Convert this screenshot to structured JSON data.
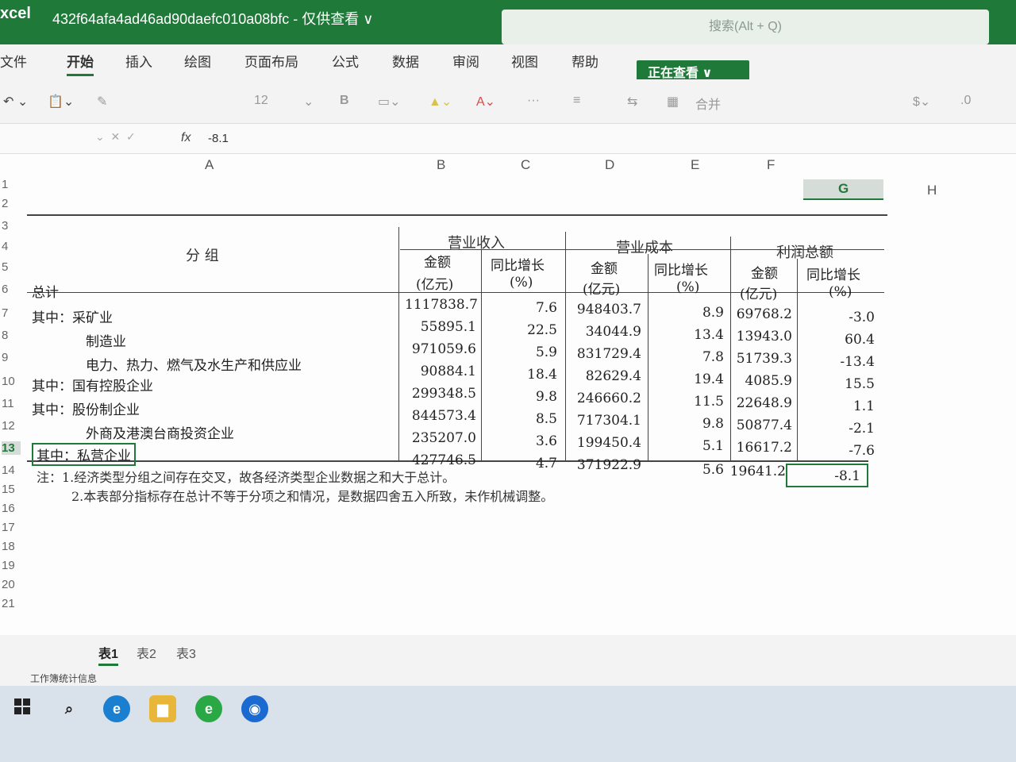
{
  "titlebar": {
    "app_name": "xcel",
    "doc_title": "432f64afa4ad46ad90daefc010a08bfc - 仅供查看 ∨",
    "search_placeholder": "搜索(Alt + Q)"
  },
  "ribbon": {
    "tabs": [
      "文件",
      "开始",
      "插入",
      "绘图",
      "页面布局",
      "公式",
      "数据",
      "审阅",
      "视图",
      "帮助"
    ],
    "active_tab": "开始",
    "viewing_button": "正在查看 ∨"
  },
  "toolbar": {
    "font_size": "12",
    "merge_label": "合并"
  },
  "formula_bar": {
    "fx": "fx",
    "value": "-8.1"
  },
  "columns": [
    "A",
    "B",
    "C",
    "D",
    "E",
    "F",
    "G",
    "H"
  ],
  "selected_column": "G",
  "rows": [
    "1",
    "2",
    "3",
    "4",
    "5",
    "6",
    "7",
    "8",
    "9",
    "10",
    "11",
    "12",
    "13",
    "14",
    "15",
    "16",
    "17",
    "18",
    "19",
    "20",
    "21"
  ],
  "selected_row": "13",
  "table": {
    "group_header": "分 组",
    "revenue_header": "营业收入",
    "cost_header": "营业成本",
    "profit_header": "利润总额",
    "amount_label": "金额",
    "amount_unit": "(亿元)",
    "growth_label": "同比增长",
    "growth_unit": "(%)",
    "rows": [
      {
        "label": "总计",
        "rev": "1117838.7",
        "rev_g": "7.6",
        "cost": "948403.7",
        "cost_g": "8.9",
        "profit": "69768.2",
        "profit_g": "-3.0"
      },
      {
        "label": "其中：采矿业",
        "rev": "55895.1",
        "rev_g": "22.5",
        "cost": "34044.9",
        "cost_g": "13.4",
        "profit": "13943.0",
        "profit_g": "60.4"
      },
      {
        "label": "制造业",
        "rev": "971059.6",
        "rev_g": "5.9",
        "cost": "831729.4",
        "cost_g": "7.8",
        "profit": "51739.3",
        "profit_g": "-13.4"
      },
      {
        "label": "电力、热力、燃气及水生产和供应业",
        "rev": "90884.1",
        "rev_g": "18.4",
        "cost": "82629.4",
        "cost_g": "19.4",
        "profit": "4085.9",
        "profit_g": "15.5"
      },
      {
        "label": "其中：国有控股企业",
        "rev": "299348.5",
        "rev_g": "9.8",
        "cost": "246660.2",
        "cost_g": "11.5",
        "profit": "22648.9",
        "profit_g": "1.1"
      },
      {
        "label": "其中：股份制企业",
        "rev": "844573.4",
        "rev_g": "8.5",
        "cost": "717304.1",
        "cost_g": "9.8",
        "profit": "50877.4",
        "profit_g": "-2.1"
      },
      {
        "label": "外商及港澳台商投资企业",
        "rev": "235207.0",
        "rev_g": "3.6",
        "cost": "199450.4",
        "cost_g": "5.1",
        "profit": "16617.2",
        "profit_g": "-7.6"
      },
      {
        "label": "其中：私营企业",
        "rev": "427746.5",
        "rev_g": "4.7",
        "cost": "371922.9",
        "cost_g": "5.6",
        "profit": "19641.2",
        "profit_g": "-8.1"
      }
    ],
    "note1": "注：1.经济类型分组之间存在交叉，故各经济类型企业数据之和大于总计。",
    "note2": "2.本表部分指标存在总计不等于分项之和情况，是数据四舍五入所致，未作机械调整。"
  },
  "sheets": [
    "表1",
    "表2",
    "表3"
  ],
  "active_sheet": "表1",
  "status": "工作簿统计信息",
  "colors": {
    "accent": "#1f7a3a"
  }
}
